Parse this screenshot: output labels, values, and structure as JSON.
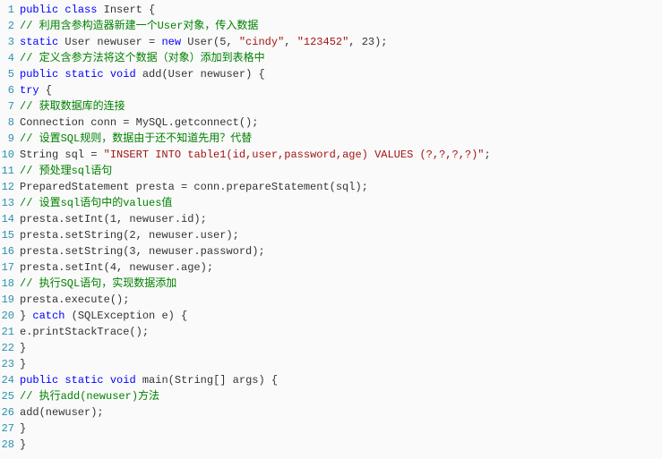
{
  "lines": [
    {
      "num": "1",
      "tokens": [
        {
          "t": "public",
          "c": "kw"
        },
        {
          "t": " ",
          "c": "plain"
        },
        {
          "t": "class",
          "c": "kw"
        },
        {
          "t": " Insert {",
          "c": "plain"
        }
      ],
      "indent": 0
    },
    {
      "num": "2",
      "tokens": [
        {
          "t": "// 利用含参构造器新建一个User对象，传入数据",
          "c": "comment"
        }
      ],
      "indent": 1
    },
    {
      "num": "3",
      "tokens": [
        {
          "t": "static",
          "c": "kw"
        },
        {
          "t": " User newuser = ",
          "c": "plain"
        },
        {
          "t": "new",
          "c": "kw"
        },
        {
          "t": " User(5, ",
          "c": "plain"
        },
        {
          "t": "\"cindy\"",
          "c": "string"
        },
        {
          "t": ", ",
          "c": "plain"
        },
        {
          "t": "\"123452\"",
          "c": "string"
        },
        {
          "t": ", 23);",
          "c": "plain"
        }
      ],
      "indent": 1
    },
    {
      "num": "4",
      "tokens": [
        {
          "t": "// 定义含参方法将这个数据（对象）添加到表格中",
          "c": "comment"
        }
      ],
      "indent": 1
    },
    {
      "num": "5",
      "tokens": [
        {
          "t": "public",
          "c": "kw"
        },
        {
          "t": " ",
          "c": "plain"
        },
        {
          "t": "static",
          "c": "kw"
        },
        {
          "t": " ",
          "c": "plain"
        },
        {
          "t": "void",
          "c": "kw"
        },
        {
          "t": " add(User newuser) {",
          "c": "plain"
        }
      ],
      "indent": 1
    },
    {
      "num": "6",
      "tokens": [
        {
          "t": "try",
          "c": "kw"
        },
        {
          "t": " {",
          "c": "plain"
        }
      ],
      "indent": 2
    },
    {
      "num": "7",
      "tokens": [
        {
          "t": "// 获取数据库的连接",
          "c": "comment"
        }
      ],
      "indent": 3
    },
    {
      "num": "8",
      "tokens": [
        {
          "t": "Connection conn = MySQL.getconnect();",
          "c": "plain"
        }
      ],
      "indent": 3
    },
    {
      "num": "9",
      "tokens": [
        {
          "t": "// 设置SQL规则，数据由于还不知道先用？代替",
          "c": "comment"
        }
      ],
      "indent": 3
    },
    {
      "num": "10",
      "tokens": [
        {
          "t": "String sql = ",
          "c": "plain"
        },
        {
          "t": "\"INSERT INTO table1(id,user,password,age) VALUES (?,?,?,?)\"",
          "c": "string"
        },
        {
          "t": ";",
          "c": "plain"
        }
      ],
      "indent": 3
    },
    {
      "num": "11",
      "tokens": [
        {
          "t": "// 预处理sql语句",
          "c": "comment"
        }
      ],
      "indent": 3
    },
    {
      "num": "12",
      "tokens": [
        {
          "t": "PreparedStatement presta = conn.prepareStatement(sql);",
          "c": "plain"
        }
      ],
      "indent": 3
    },
    {
      "num": "13",
      "tokens": [
        {
          "t": "// 设置sql语句中的values值",
          "c": "comment"
        }
      ],
      "indent": 3
    },
    {
      "num": "14",
      "tokens": [
        {
          "t": "presta.setInt(1, newuser.id);",
          "c": "plain"
        }
      ],
      "indent": 3
    },
    {
      "num": "15",
      "tokens": [
        {
          "t": "presta.setString(2, newuser.user);",
          "c": "plain"
        }
      ],
      "indent": 3
    },
    {
      "num": "16",
      "tokens": [
        {
          "t": "presta.setString(3, newuser.password);",
          "c": "plain"
        }
      ],
      "indent": 3
    },
    {
      "num": "17",
      "tokens": [
        {
          "t": "presta.setInt(4, newuser.age);",
          "c": "plain"
        }
      ],
      "indent": 3
    },
    {
      "num": "18",
      "tokens": [
        {
          "t": "// 执行SQL语句，实现数据添加",
          "c": "comment"
        }
      ],
      "indent": 3
    },
    {
      "num": "19",
      "tokens": [
        {
          "t": "presta.execute();",
          "c": "plain"
        }
      ],
      "indent": 3
    },
    {
      "num": "20",
      "tokens": [
        {
          "t": "} ",
          "c": "plain"
        },
        {
          "t": "catch",
          "c": "kw"
        },
        {
          "t": " (SQLException e) {",
          "c": "plain"
        }
      ],
      "indent": 2
    },
    {
      "num": "21",
      "tokens": [
        {
          "t": "e.printStackTrace();",
          "c": "plain"
        }
      ],
      "indent": 3
    },
    {
      "num": "22",
      "tokens": [
        {
          "t": "}",
          "c": "plain"
        }
      ],
      "indent": 2
    },
    {
      "num": "23",
      "tokens": [
        {
          "t": "}",
          "c": "plain"
        }
      ],
      "indent": 1
    },
    {
      "num": "24",
      "tokens": [
        {
          "t": "public",
          "c": "kw"
        },
        {
          "t": " ",
          "c": "plain"
        },
        {
          "t": "static",
          "c": "kw"
        },
        {
          "t": " ",
          "c": "plain"
        },
        {
          "t": "void",
          "c": "kw"
        },
        {
          "t": " main(String[] args) {",
          "c": "plain"
        }
      ],
      "indent": 1
    },
    {
      "num": "25",
      "tokens": [
        {
          "t": "// 执行add(newuser)方法",
          "c": "comment"
        }
      ],
      "indent": 2
    },
    {
      "num": "26",
      "tokens": [
        {
          "t": "add(newuser);",
          "c": "plain"
        }
      ],
      "indent": 2
    },
    {
      "num": "27",
      "tokens": [
        {
          "t": "}",
          "c": "plain"
        }
      ],
      "indent": 1
    },
    {
      "num": "28",
      "tokens": [
        {
          "t": "}",
          "c": "plain"
        }
      ],
      "indent": 0
    }
  ],
  "indentUnit": "    "
}
